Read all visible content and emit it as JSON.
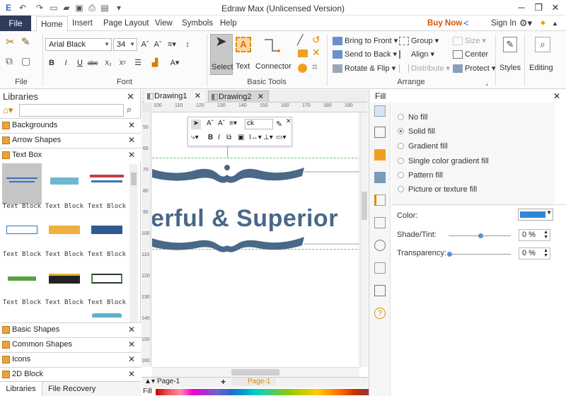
{
  "app": {
    "title": "Edraw Max (Unlicensed Version)",
    "buy_now": "Buy Now",
    "sign_in": "Sign In"
  },
  "menu": {
    "file": "File",
    "tabs": [
      "Home",
      "Insert",
      "Page Layout",
      "View",
      "Symbols",
      "Help"
    ],
    "active": "Home"
  },
  "ribbon": {
    "file_group": "File",
    "font_group": "Font",
    "font_name": "Arial Black",
    "font_size": "34",
    "basic_tools_group": "Basic Tools",
    "tools": [
      "Select",
      "Text",
      "Connector"
    ],
    "arrange_group": "Arrange",
    "arrange": {
      "bring_to_front": "Bring to Front",
      "send_to_back": "Send to Back",
      "rotate_flip": "Rotate & Flip",
      "group": "Group",
      "align": "Align",
      "distribute": "Distribute",
      "size": "Size",
      "center": "Center",
      "protect": "Protect"
    },
    "styles": "Styles",
    "editing": "Editing"
  },
  "libraries": {
    "title": "Libraries",
    "categories_top": [
      "Backgrounds",
      "Arrow Shapes",
      "Text Box"
    ],
    "thumb_label": "Text Block",
    "categories_bottom": [
      "Basic Shapes",
      "Common Shapes",
      "Icons",
      "2D Block"
    ],
    "bottom_tabs": [
      "Libraries",
      "File Recovery"
    ]
  },
  "documents": {
    "tabs": [
      "Drawing1",
      "Drawing2"
    ],
    "active": "Drawing2"
  },
  "canvas": {
    "text": "erful & Superior",
    "ruler_h": [
      "100",
      "110",
      "120",
      "130",
      "140",
      "150",
      "160",
      "170",
      "180",
      "190"
    ],
    "ruler_v": [
      "50",
      "60",
      "70",
      "80",
      "90",
      "100",
      "110",
      "120",
      "130",
      "140",
      "150",
      "160"
    ],
    "toolbar_font_fragment": "ck"
  },
  "fill": {
    "title": "Fill",
    "options": [
      "No fill",
      "Solid fill",
      "Gradient fill",
      "Single color gradient fill",
      "Pattern fill",
      "Picture or texture fill"
    ],
    "selected": "Solid fill",
    "color_label": "Color:",
    "color_value": "#2f86d6",
    "shade_label": "Shade/Tint:",
    "shade_value": "0 %",
    "transparency_label": "Transparency:",
    "transparency_value": "0 %"
  },
  "status": {
    "page_name": "Page-1",
    "active_page": "Page-1",
    "fill_label": "Fill"
  }
}
